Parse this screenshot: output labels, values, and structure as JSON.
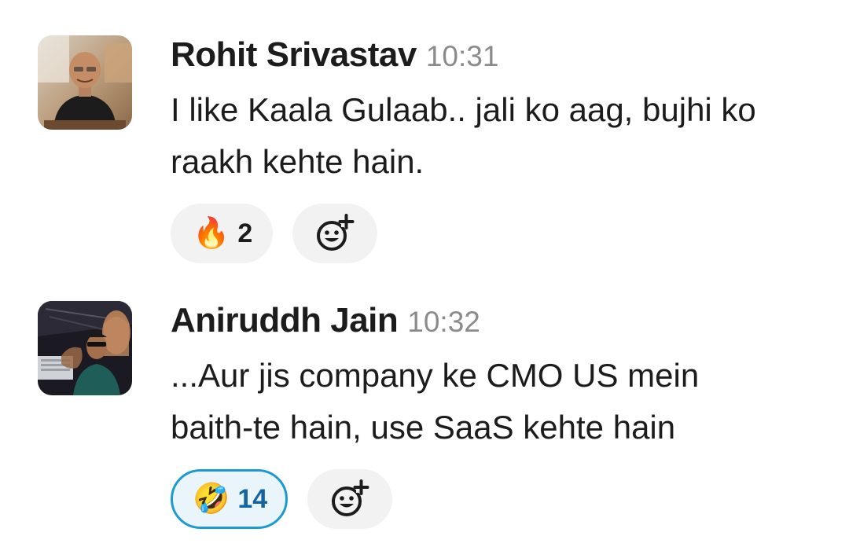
{
  "messages": [
    {
      "author": "Rohit Srivastav",
      "time": "10:31",
      "text_lines": [
        "I like Kaala Gulaab.. jali ko aag, bujhi ko",
        "raakh kehte hain."
      ],
      "reactions": [
        {
          "emoji": "🔥",
          "icon": "fire-emoji",
          "count": "2",
          "active": false
        }
      ],
      "add_reaction_icon": "add-reaction-icon"
    },
    {
      "author": "Aniruddh Jain",
      "time": "10:32",
      "text_lines": [
        "...Aur jis company ke CMO US mein",
        "baith-te hain, use SaaS kehte hain"
      ],
      "reactions": [
        {
          "emoji": "🤣",
          "icon": "rofl-emoji",
          "count": "14",
          "active": true
        }
      ],
      "add_reaction_icon": "add-reaction-icon"
    }
  ],
  "colors": {
    "author": "#1d1c1d",
    "timestamp": "#8b8b8b",
    "pill_bg": "#f2f2f2",
    "active_border": "#1d9bd1",
    "active_bg": "#eaf5fb",
    "active_count": "#1264a3"
  }
}
